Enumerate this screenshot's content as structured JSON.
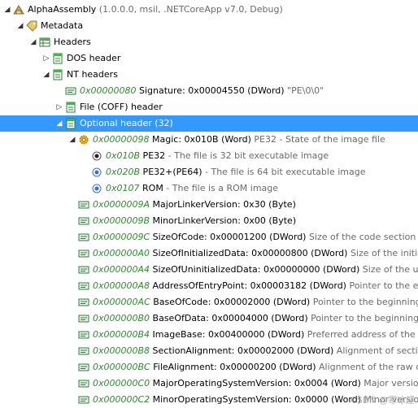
{
  "rows": [
    {
      "depth": 0,
      "toggle": "open",
      "icon": "assembly",
      "offset": "",
      "label": "AlphaAssembly",
      "desc": " (1.0.0.0, msil, .NETCoreApp v7.0, Debug)"
    },
    {
      "depth": 1,
      "toggle": "open",
      "icon": "tag",
      "offset": "",
      "label": "Metadata",
      "desc": ""
    },
    {
      "depth": 2,
      "toggle": "open",
      "icon": "table",
      "offset": "",
      "label": "Headers",
      "desc": ""
    },
    {
      "depth": 3,
      "toggle": "closed",
      "icon": "header",
      "offset": "",
      "label": "DOS header",
      "desc": ""
    },
    {
      "depth": 3,
      "toggle": "open",
      "icon": "header",
      "offset": "",
      "label": "NT headers",
      "desc": ""
    },
    {
      "depth": 4,
      "toggle": "none",
      "icon": "field",
      "offset": "0x00000080",
      "label": " Signature: 0x00004550 (DWord)",
      "desc": " \"PE\\0\\0\""
    },
    {
      "depth": 4,
      "toggle": "closed",
      "icon": "header",
      "offset": "",
      "label": "File (COFF) header",
      "desc": ""
    },
    {
      "depth": 4,
      "toggle": "open",
      "icon": "header",
      "offset": "",
      "label": "Optional header (32)",
      "desc": "",
      "selected": true
    },
    {
      "depth": 5,
      "toggle": "open",
      "icon": "gear",
      "offset": "0x00000098",
      "label": " Magic: 0x010B (Word)",
      "desc": " PE32 - State of the image file"
    },
    {
      "depth": 6,
      "toggle": "none",
      "icon": "radio-checked",
      "offset": "0x010B",
      "label": " PE32",
      "desc": " - The file is 32 bit executable image"
    },
    {
      "depth": 6,
      "toggle": "none",
      "icon": "radio",
      "offset": "0x020B",
      "label": " PE32+(PE64)",
      "desc": " - The file is 64 bit executable image"
    },
    {
      "depth": 6,
      "toggle": "none",
      "icon": "radio",
      "offset": "0x0107",
      "label": " ROM",
      "desc": " - The file is a ROM image"
    },
    {
      "depth": 5,
      "toggle": "none",
      "icon": "field",
      "offset": "0x0000009A",
      "label": " MajorLinkerVersion: 0x30 (Byte)",
      "desc": ""
    },
    {
      "depth": 5,
      "toggle": "none",
      "icon": "field",
      "offset": "0x0000009B",
      "label": " MinorLinkerVersion: 0x00 (Byte)",
      "desc": ""
    },
    {
      "depth": 5,
      "toggle": "none",
      "icon": "field",
      "offset": "0x0000009C",
      "label": " SizeOfCode: 0x00001200 (DWord)",
      "desc": " Size of the code section"
    },
    {
      "depth": 5,
      "toggle": "none",
      "icon": "field",
      "offset": "0x000000A0",
      "label": " SizeOfInitializedData: 0x00000800 (DWord)",
      "desc": " Size of the initialized d"
    },
    {
      "depth": 5,
      "toggle": "none",
      "icon": "field",
      "offset": "0x000000A4",
      "label": " SizeOfUninitializedData: 0x00000000 (DWord)",
      "desc": " Size of the uninitia"
    },
    {
      "depth": 5,
      "toggle": "none",
      "icon": "field",
      "offset": "0x000000A8",
      "label": " AddressOfEntryPoint: 0x00003182 (DWord)",
      "desc": " Pointer to the entry p"
    },
    {
      "depth": 5,
      "toggle": "none",
      "icon": "field",
      "offset": "0x000000AC",
      "label": " BaseOfCode: 0x00002000 (DWord)",
      "desc": " Pointer to the beginning of th"
    },
    {
      "depth": 5,
      "toggle": "none",
      "icon": "field",
      "offset": "0x000000B0",
      "label": " BaseOfData: 0x00004000 (DWord)",
      "desc": " Pointer to the beginning of the"
    },
    {
      "depth": 5,
      "toggle": "none",
      "icon": "field",
      "offset": "0x000000B4",
      "label": " ImageBase: 0x00400000 (DWord)",
      "desc": " Preferred address of the first by"
    },
    {
      "depth": 5,
      "toggle": "none",
      "icon": "field",
      "offset": "0x000000B8",
      "label": " SectionAlignment: 0x00002000 (DWord)",
      "desc": " Alignment of sections lo"
    },
    {
      "depth": 5,
      "toggle": "none",
      "icon": "field",
      "offset": "0x000000BC",
      "label": " FileAlignment: 0x00000200 (DWord)",
      "desc": " Alignment of the raw data o"
    },
    {
      "depth": 5,
      "toggle": "none",
      "icon": "field",
      "offset": "0x000000C0",
      "label": " MajorOperatingSystemVersion: 0x0004 (Word)",
      "desc": " Major version nu"
    },
    {
      "depth": 5,
      "toggle": "none",
      "icon": "field",
      "offset": "0x000000C2",
      "label": " MinorOperatingSystemVersion: 0x0000 (Word)",
      "desc": " Minor version nu"
    }
  ],
  "watermark": "CSDN @寒冰屋",
  "colors": {
    "selection": "#3399ff",
    "offset": "#2e8b2e",
    "description": "#6a6a6a"
  }
}
